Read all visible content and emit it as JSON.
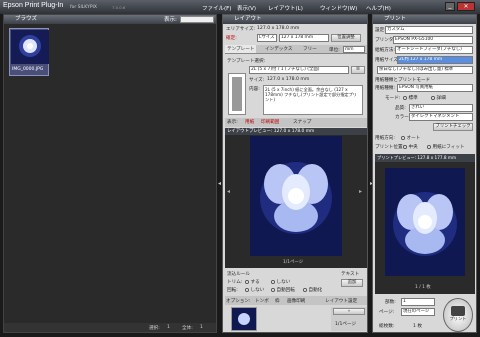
{
  "app": {
    "title": "Epson Print Plug-In",
    "subtitle": "for SILKYPIX",
    "version": "7.0.0.6"
  },
  "menu": [
    "ファイル(F)",
    "表示(V)",
    "レイアウト(L)",
    "ウィンドウ(W)",
    "ヘルプ(H)"
  ],
  "browser": {
    "title": "ブラウズ",
    "thumb_name": "IMG_0000.JPG",
    "status_selected_label": "選択:",
    "status_selected": "1",
    "status_total_label": "全体:",
    "status_total": "1",
    "view_label": "表示:"
  },
  "layout": {
    "title": "レイアウト",
    "area_size_label": "エリアサイズ:",
    "area_size": "127.0 x 178.0 mm",
    "adjust_label": "確定:",
    "paper_size_label": "Lサイズ",
    "paper_size": "127 x 178 mm",
    "preview_btn": "位置調整",
    "tabs": [
      "テンプレート",
      "インデックス",
      "フリー"
    ],
    "unit_label": "単位:",
    "unit": "mm",
    "template_select_label": "テンプレート選択:",
    "template": "2L (5 x 7)付 / 1 (フチなし) (全面)",
    "size_label": "サイズ:",
    "size": "127.0 x 178.0 mm",
    "content_label": "内容:",
    "content": "2L (5 x 7inch) 紙に全面。余白なし (127 x 178mm) フチなし(プリント設定で部分指定プリント)",
    "view_tabs": [
      "表示:",
      "用紙",
      "印刷範囲",
      "スナップ"
    ],
    "preview_title": "レイアウトプレビュー: 127.0 x 178.0 mm",
    "page_indicator": "1/1ページ",
    "trim_title": "流込ルール",
    "trim_label": "トリム:",
    "trim_yes": "する",
    "trim_no": "しない",
    "rotate_label": "回転:",
    "rotate_no": "しない",
    "rotate_auto": "自動回転",
    "rotate_auto2": "自動化",
    "text_label": "テキスト",
    "text_btn": "追加",
    "option_label": "オプション:",
    "option_value": "トンボ",
    "option2": "枠",
    "option3": "画像印刷",
    "layout_btn": "レイアウト設定",
    "page_count": "1/1ページ"
  },
  "print": {
    "title": "プリント",
    "preset_label": "設定:",
    "preset": "カスタム",
    "printer_label": "プリンタ:",
    "printer": "EPSON PX-G5100",
    "source_label": "給紙方法:",
    "source": "オートシートフィーダ(フチなし)",
    "paper_size_label": "用紙サイズ:",
    "paper_size": "2L判 127 x 178 mm",
    "expand_label": "余白なし(フチなし)(はみ出し量)",
    "expand": "標準",
    "media_section": "用紙種類とプリントモード",
    "media_label": "用紙種類:",
    "media": "EPSON 写真用紙",
    "mode_label": "モード:",
    "mode_std": "標準",
    "mode_detail": "詳細",
    "quality_label": "品質:",
    "quality": "きれい",
    "color_label": "カラー:",
    "color": "ダイレクトマネジメント",
    "check_btn": "プリントチェック",
    "direction_label": "用紙方向:",
    "direction": "オート",
    "position_label": "プリント位置:",
    "position_center": "中央",
    "position_fit": "用紙にフィット",
    "preview_title": "プリントプレビュー: 127.8 x 177.8 mm",
    "sheet_indicator": "1 / 1 枚",
    "copies_label": "部数:",
    "copies": "1",
    "pages_label": "ページ:",
    "pages": "現在のページ",
    "total_label": "総枚数:",
    "total": "1 枚",
    "print_btn": "プリント"
  },
  "colors": {
    "accent": "#5a8ee0",
    "titlebar": "#3c4047",
    "flower_bg": "#141e5a"
  }
}
